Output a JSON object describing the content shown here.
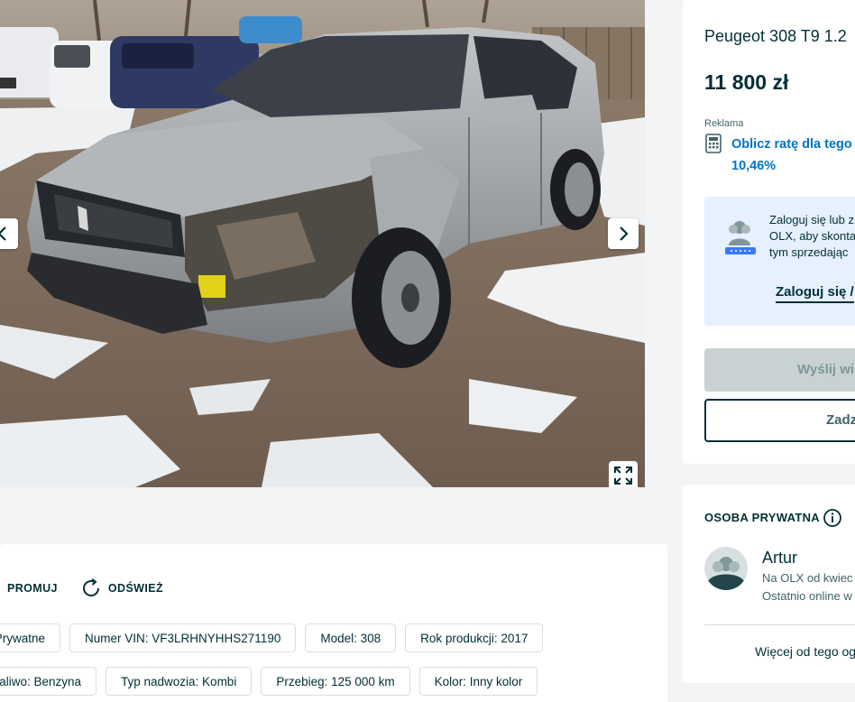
{
  "gallery": {
    "prev_icon": "chevron-left-icon",
    "next_icon": "chevron-right-icon",
    "expand_icon": "fullscreen-expand-icon"
  },
  "actions": [
    {
      "label": "PROMUJ"
    },
    {
      "label": "ODŚWIEŻ",
      "icon": "refresh-icon"
    }
  ],
  "params": {
    "row1": [
      "Prywatne",
      "Numer VIN: VF3LRHNYHHS271190",
      "Model: 308",
      "Rok produkcji: 2017"
    ],
    "row2": [
      "Paliwo: Benzyna",
      "Typ nadwozia: Kombi",
      "Przebieg: 125 000 km",
      "Kolor: Inny kolor"
    ]
  },
  "listing": {
    "title": "Peugeot 308 T9 1.2",
    "price": "11 800 zł"
  },
  "ad": {
    "label": "Reklama",
    "loan_line1": "Oblicz ratę dla tego",
    "loan_line2": "10,46%",
    "icon": "calculator-icon"
  },
  "login_box": {
    "line1": "Zaloguj się lub z",
    "line2": "OLX, aby skonta",
    "line3": "tym sprzedając",
    "link": "Zaloguj się /",
    "icon": "user-lock-icon"
  },
  "buttons": {
    "message": "Wyślij wi",
    "call": "Zadz"
  },
  "seller": {
    "type": "OSOBA PRYWATNA",
    "info_icon": "info-icon",
    "name": "Artur",
    "since": "Na OLX od kwiec",
    "online": "Ostatnio online w",
    "more": "Więcej od tego og"
  },
  "colors": {
    "page_bg": "#f2f4f5",
    "text": "#002f34",
    "link_blue": "#0074c7",
    "login_bg": "#e6f0ff",
    "disabled_btn": "#c8d2d3"
  }
}
